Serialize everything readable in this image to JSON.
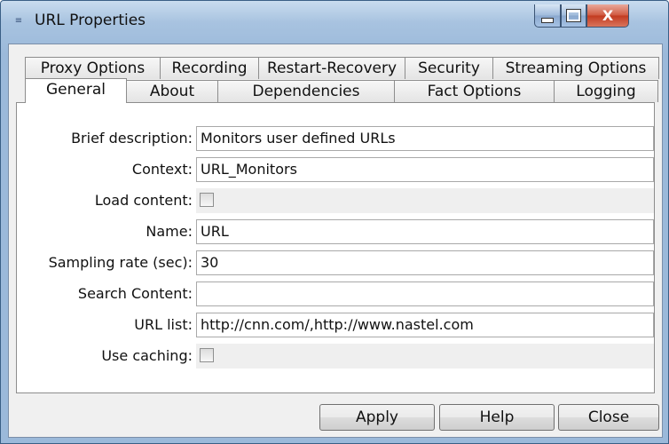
{
  "window": {
    "title": "URL Properties",
    "icon": "properties-app-icon",
    "controls": {
      "minimize": "minimize-icon",
      "maximize": "maximize-icon",
      "close": "X"
    }
  },
  "tabs_row1": [
    "Proxy Options",
    "Recording",
    "Restart-Recovery",
    "Security",
    "Streaming Options"
  ],
  "tabs_row2": [
    "General",
    "About",
    "Dependencies",
    "Fact Options",
    "Logging"
  ],
  "active_tab": "General",
  "fields": [
    {
      "label": "Brief description:",
      "type": "text",
      "value": "Monitors user defined URLs"
    },
    {
      "label": "Context:",
      "type": "text",
      "value": "URL_Monitors"
    },
    {
      "label": "Load content:",
      "type": "checkbox",
      "checked": false
    },
    {
      "label": "Name:",
      "type": "text",
      "value": "URL"
    },
    {
      "label": "Sampling rate (sec):",
      "type": "text",
      "value": "30"
    },
    {
      "label": "Search Content:",
      "type": "text",
      "value": ""
    },
    {
      "label": "URL list:",
      "type": "text",
      "value": "http://cnn.com/,http://www.nastel.com"
    },
    {
      "label": "Use caching:",
      "type": "checkbox",
      "checked": false
    }
  ],
  "buttons": {
    "apply": "Apply",
    "help": "Help",
    "close": "Close"
  },
  "colors": {
    "title_bar": "#a8c3e0",
    "close_button": "#c23a1f",
    "panel": "#ffffff",
    "dialog": "#f0f0f0"
  }
}
